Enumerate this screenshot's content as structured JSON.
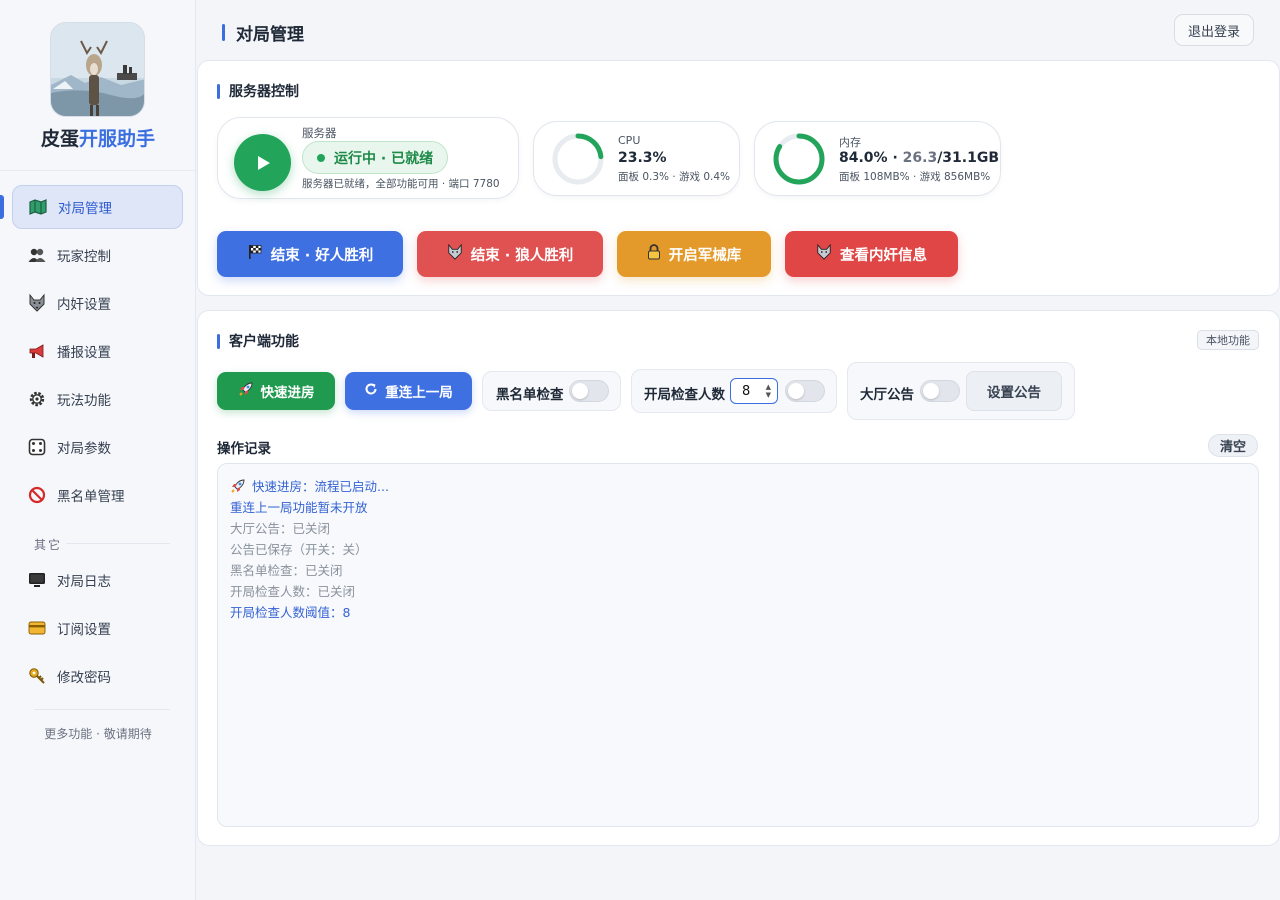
{
  "sidebar": {
    "brand_part1": "皮蛋",
    "brand_part2": "开服助手",
    "items": [
      {
        "label": "对局管理",
        "icon": "map-icon"
      },
      {
        "label": "玩家控制",
        "icon": "users-icon"
      },
      {
        "label": "内奸设置",
        "icon": "wolf-icon"
      },
      {
        "label": "播报设置",
        "icon": "megaphone-icon"
      },
      {
        "label": "玩法功能",
        "icon": "gear-icon"
      },
      {
        "label": "对局参数",
        "icon": "dice-icon"
      },
      {
        "label": "黑名单管理",
        "icon": "prohibited-icon"
      }
    ],
    "group_label": "其它",
    "other_items": [
      {
        "label": "对局日志",
        "icon": "monitor-icon"
      },
      {
        "label": "订阅设置",
        "icon": "card-icon"
      },
      {
        "label": "修改密码",
        "icon": "key-icon"
      }
    ],
    "more_text": "更多功能 · 敬请期待"
  },
  "header": {
    "title": "对局管理",
    "logout_label": "退出登录"
  },
  "server_control": {
    "title": "服务器控制",
    "server": {
      "label": "服务器",
      "status": "运行中 · 已就绪",
      "detail": "服务器已就绪，全部功能可用 · 端口 7780"
    },
    "cpu": {
      "label": "CPU",
      "value": "23.3%",
      "percent": 23.3,
      "detail": "面板 0.3% · 游戏 0.4%"
    },
    "memory": {
      "label": "内存",
      "value_prefix": "84.0% · ",
      "used": "26.3",
      "total": "/31.1GB",
      "percent": 84.0,
      "detail": "面板 108MB% · 游戏 856MB%"
    },
    "actions": [
      {
        "label": "结束 · 好人胜利",
        "icon": "flag-icon"
      },
      {
        "label": "结束 · 狼人胜利",
        "icon": "wolf-icon"
      },
      {
        "label": "开启军械库",
        "icon": "lock-icon"
      },
      {
        "label": "查看内奸信息",
        "icon": "wolf-icon"
      }
    ]
  },
  "client": {
    "title": "客户端功能",
    "tag": "本地功能",
    "quick_join": "快速进房",
    "reconnect": "重连上一局",
    "blacklist_check": "黑名单检查",
    "headcount_label": "开局检查人数",
    "headcount_value": "8",
    "lobby_notice": "大厅公告",
    "set_notice": "设置公告",
    "log_title": "操作记录",
    "clear_label": "清空",
    "logs": [
      {
        "text": "快速进房：流程已启动...",
        "tone": "blue",
        "icon": "rocket-icon"
      },
      {
        "text": "重连上一局功能暂未开放",
        "tone": "blue"
      },
      {
        "text": "大厅公告：已关闭",
        "tone": "gray"
      },
      {
        "text": "公告已保存（开关：关）",
        "tone": "gray"
      },
      {
        "text": "黑名单检查：已关闭",
        "tone": "gray"
      },
      {
        "text": "开局检查人数：已关闭",
        "tone": "gray"
      },
      {
        "text": "开局检查人数阈值：8",
        "tone": "blue"
      }
    ]
  }
}
